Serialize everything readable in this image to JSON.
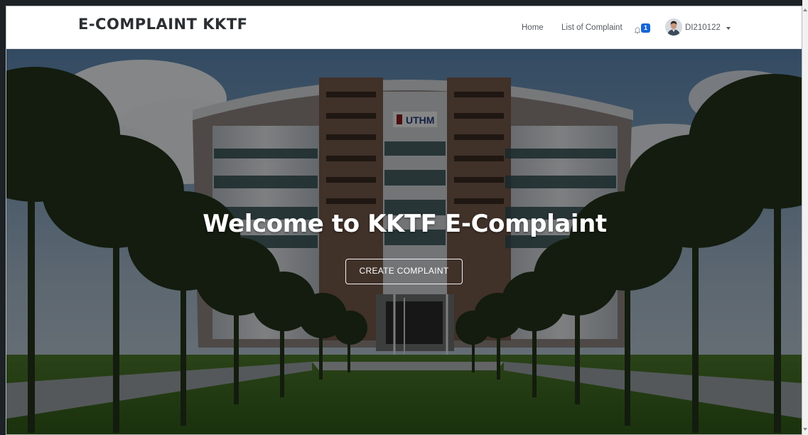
{
  "navbar": {
    "brand": "E-COMPLAINT KKTF",
    "links": [
      "Home",
      "List of Complaint"
    ],
    "notifications": {
      "icon": "bell-icon",
      "count": "1"
    },
    "user": {
      "name": "DI210122",
      "avatar_icon": "user-avatar"
    }
  },
  "hero": {
    "building_sign": "UTHM",
    "title": "Welcome to KKTF E-Complaint",
    "cta_label": "CREATE COMPLAINT"
  },
  "colors": {
    "brand_text": "#2b2f33",
    "badge": "#1565d8",
    "hero_overlay": "rgba(0,0,0,0.45)",
    "cta_border": "#f2f2f2"
  }
}
